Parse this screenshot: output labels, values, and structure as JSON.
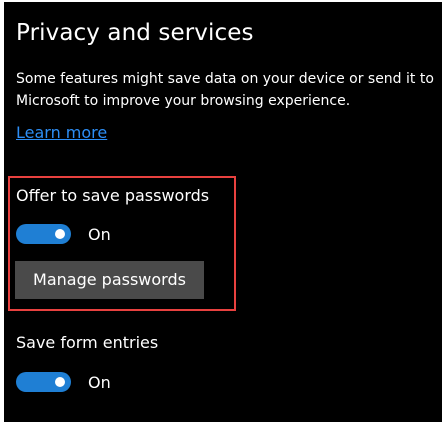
{
  "section": {
    "title": "Privacy and services",
    "description": "Some features might save data on your device or send it to Microsoft to improve your browsing experience.",
    "learn_more_label": "Learn more"
  },
  "offer_passwords": {
    "label": "Offer to save passwords",
    "toggle_state_label": "On",
    "toggle_on": true,
    "manage_button_label": "Manage passwords"
  },
  "form_entries": {
    "label": "Save form entries",
    "toggle_state_label": "On",
    "toggle_on": true
  },
  "colors": {
    "background": "#000000",
    "text": "#ffffff",
    "link": "#2d8ef5",
    "toggle_on": "#1f7fd4",
    "button_bg": "#4a4a4a",
    "highlight_border": "#e8413f"
  }
}
